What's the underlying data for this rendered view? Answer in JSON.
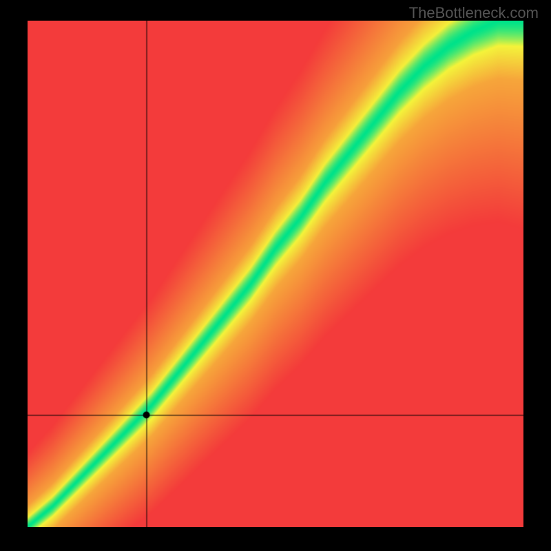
{
  "watermark": "TheBottleneck.com",
  "chart_data": {
    "type": "heatmap",
    "title": "",
    "xlabel": "",
    "ylabel": "",
    "xlim": [
      0,
      100
    ],
    "ylim": [
      0,
      100
    ],
    "crosshair": {
      "x": 24,
      "y": 22
    },
    "description": "2D color gradient heatmap. Color represents compatibility: green along a diagonal ridge (optimal balance), transitioning through yellow to orange to red away from the ridge. The ridge runs from bottom-left origin to upper-right, slightly steeper than y=x. A black dot with crosshair lines marks the queried point at roughly (24,22) in percent of axis range.",
    "color_stops": {
      "optimal": "#00e38a",
      "near": "#f4f43a",
      "mid": "#f7a63a",
      "far": "#f33b3b"
    },
    "ridge": {
      "comment": "approximate centerline of green band as (x_pct, y_pct) pairs",
      "points": [
        [
          0,
          0
        ],
        [
          5,
          4
        ],
        [
          10,
          9
        ],
        [
          15,
          14
        ],
        [
          20,
          19
        ],
        [
          25,
          24
        ],
        [
          30,
          30
        ],
        [
          35,
          36
        ],
        [
          40,
          42
        ],
        [
          45,
          48
        ],
        [
          50,
          55
        ],
        [
          55,
          61
        ],
        [
          60,
          68
        ],
        [
          65,
          74
        ],
        [
          70,
          80
        ],
        [
          75,
          86
        ],
        [
          80,
          91
        ],
        [
          85,
          95
        ],
        [
          90,
          98
        ],
        [
          95,
          100
        ]
      ],
      "band_halfwidth_pct": 6
    }
  }
}
